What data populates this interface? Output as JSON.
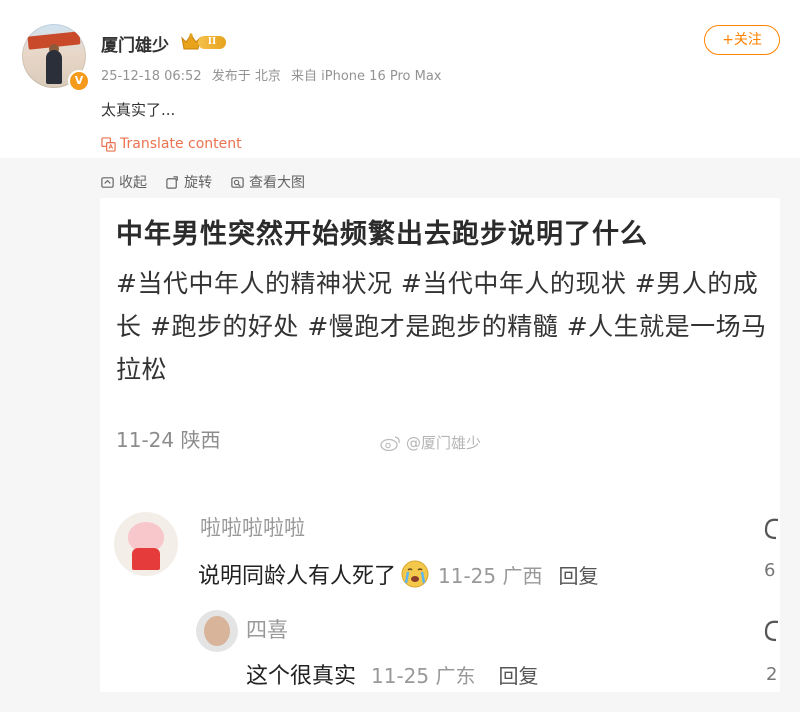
{
  "post": {
    "username": "厦门雄少",
    "level": "II",
    "verified_mark": "V",
    "follow_label": "+关注",
    "time": "25-12-18 06:52",
    "location": "发布于 北京",
    "source": "来自 iPhone 16 Pro Max",
    "text": "太真实了...",
    "translate_label": "Translate content"
  },
  "media_toolbar": {
    "collapse": "收起",
    "rotate": "旋转",
    "view_large": "查看大图"
  },
  "image": {
    "title": "中年男性突然开始频繁出去跑步说明了什么",
    "tags": "#当代中年人的精神状况 #当代中年人的现状 #男人的成长 #跑步的好处 #慢跑才是跑步的精髓 #人生就是一场马拉松",
    "date_location": "11-24 陕西",
    "watermark": "@厦门雄少",
    "comments": [
      {
        "name": "啦啦啦啦啦",
        "text": "说明同龄人有人死了",
        "time": "11-25 广西",
        "reply": "回复",
        "like_count": "6"
      },
      {
        "name": "四喜",
        "text": "这个很真实",
        "time": "11-25 广东",
        "reply": "回复",
        "like_count": "2"
      }
    ]
  },
  "colors": {
    "accent": "#ff8200",
    "translate": "#eb7350",
    "meta": "#939393",
    "panel_bg": "#f6f6f6"
  },
  "icons": [
    "verified-badge-icon",
    "crown-icon",
    "translate-icon",
    "collapse-icon",
    "rotate-icon",
    "view-large-icon",
    "weibo-logo-icon",
    "crying-emoji-icon",
    "like-icon"
  ]
}
